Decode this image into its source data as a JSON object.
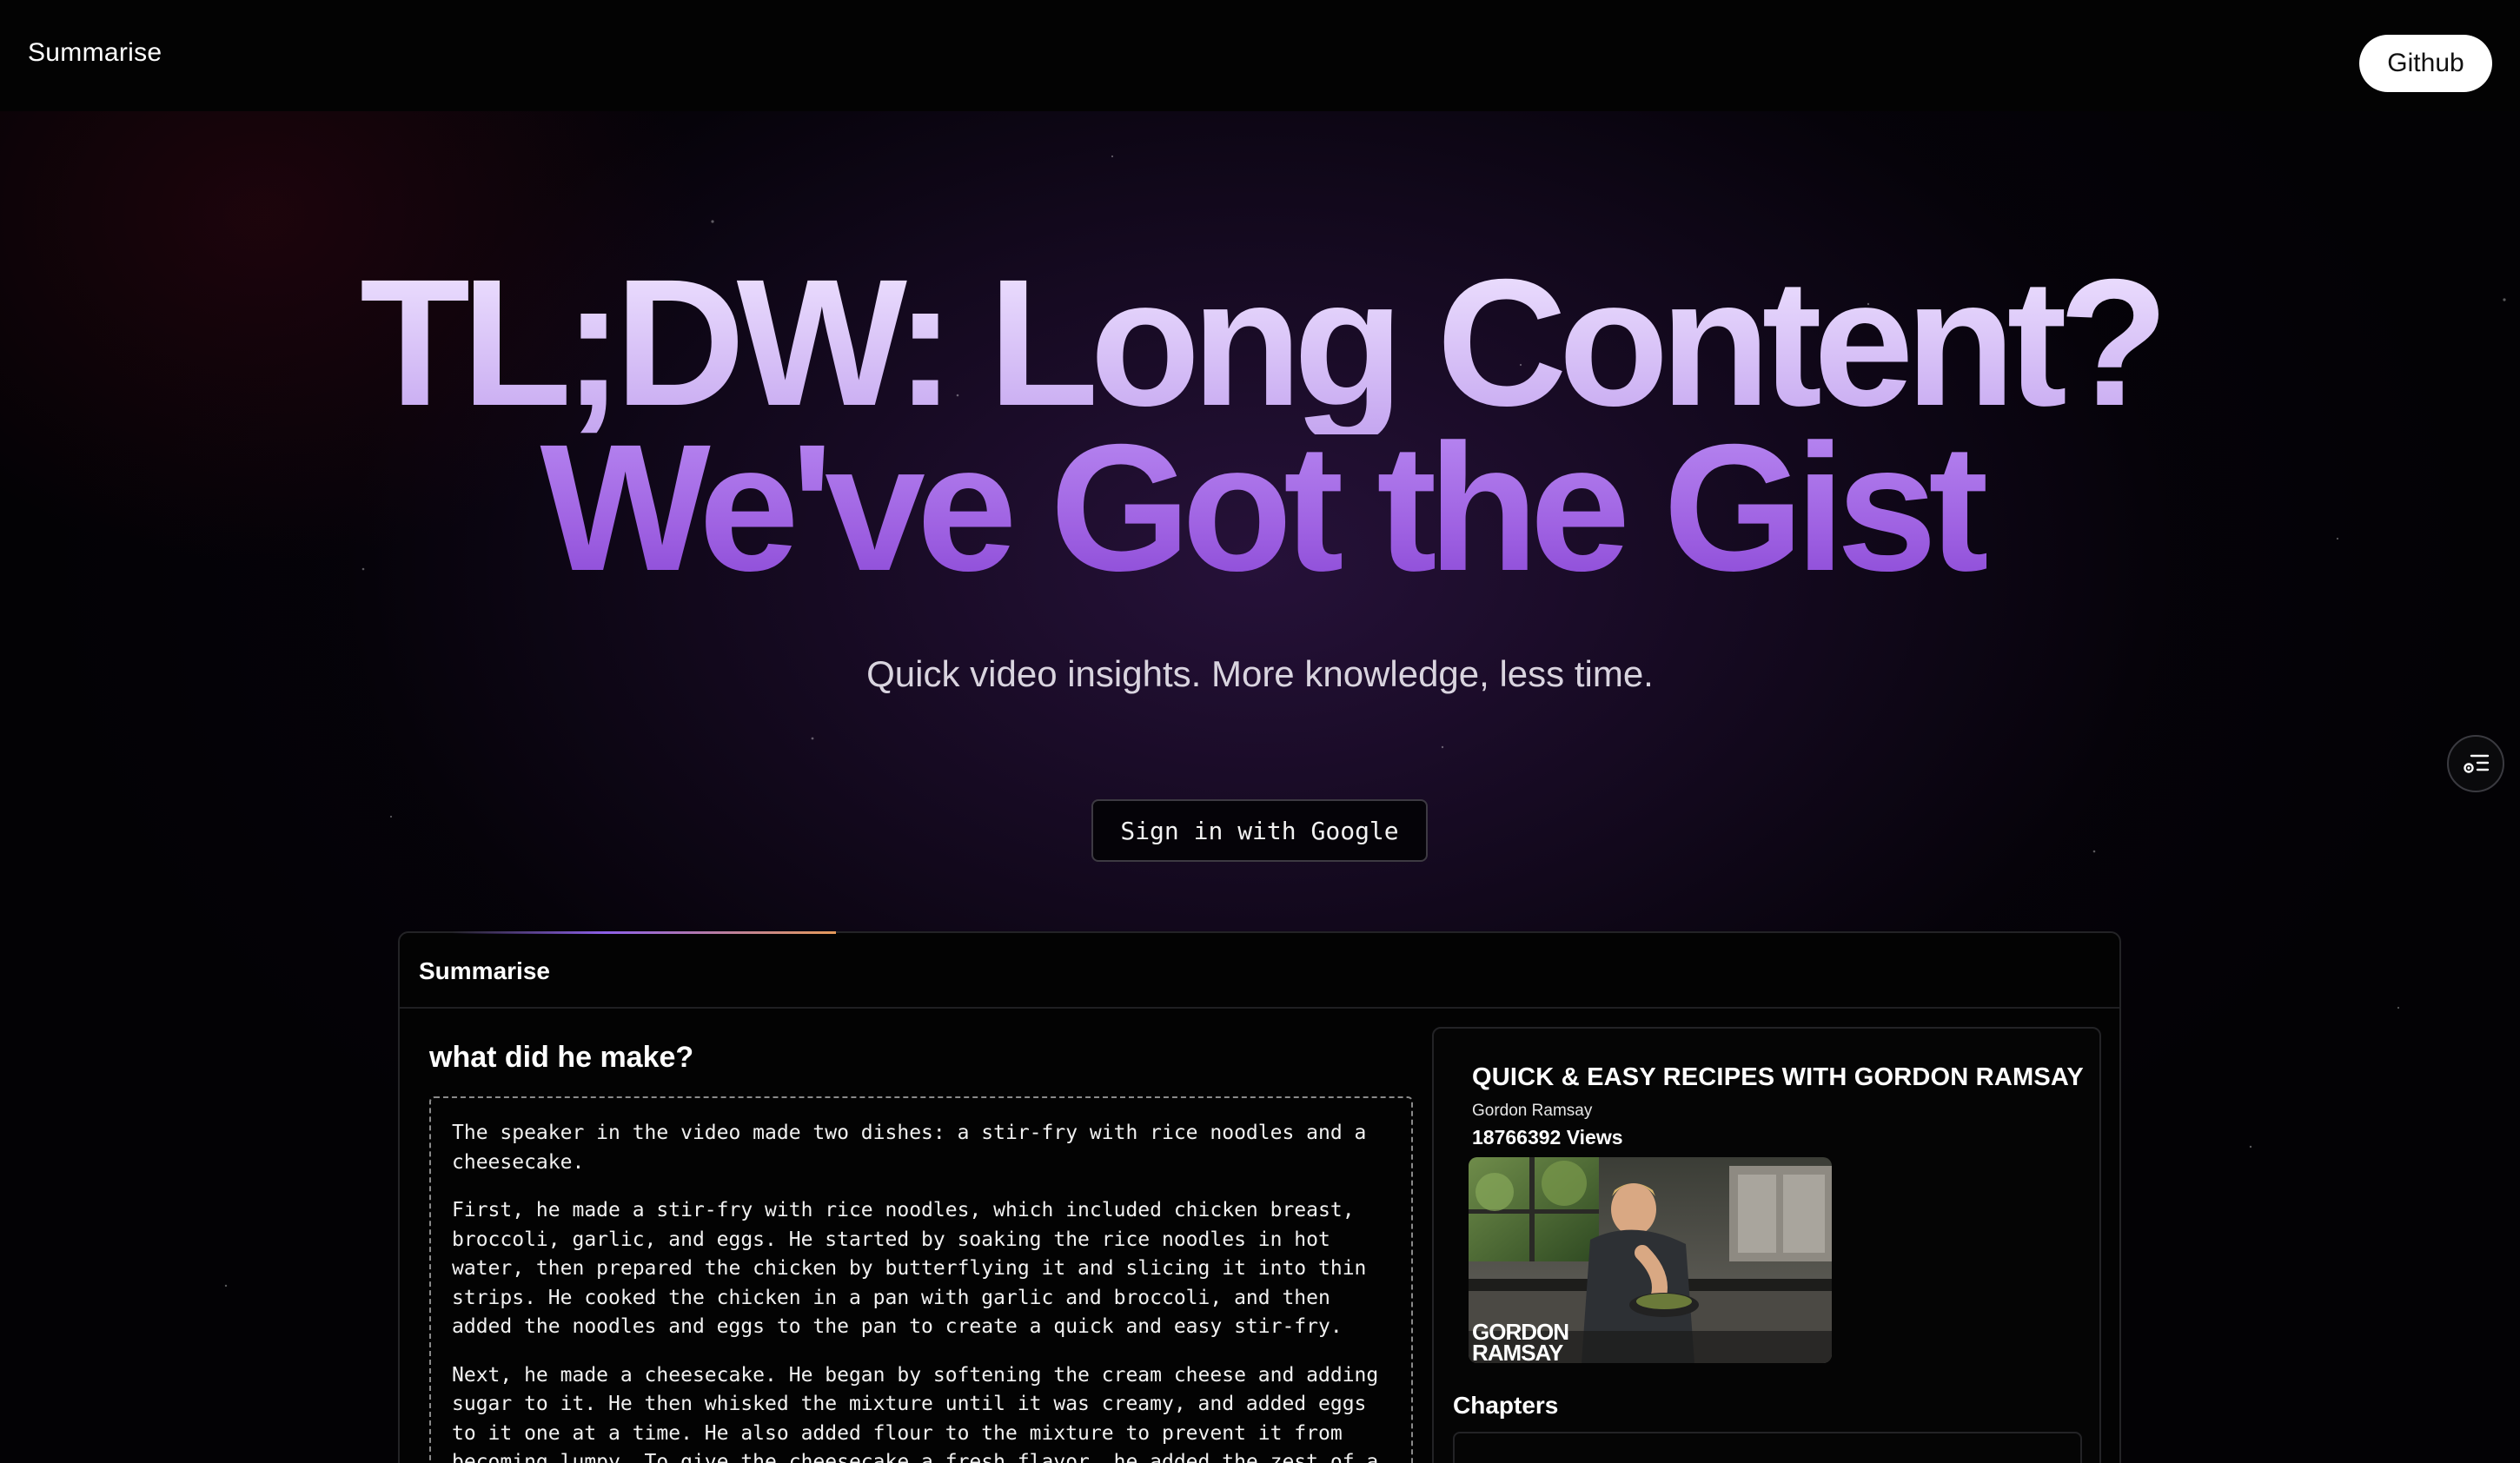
{
  "header": {
    "brand": "Summarise",
    "github_label": "Github"
  },
  "hero": {
    "line1": "TL;DW: Long Content?",
    "line2": "We've Got the Gist",
    "subtitle": "Quick video insights. More knowledge, less time.",
    "signin_label": "Sign in with Google"
  },
  "panel": {
    "title": "Summarise",
    "question": "what did he make?",
    "answer": [
      "The speaker in the video made two dishes: a stir-fry with rice noodles and a cheesecake.",
      "First, he made a stir-fry with rice noodles, which included chicken breast, broccoli, garlic, and eggs. He started by soaking the rice noodles in hot water, then prepared the chicken by butterflying it and slicing it into thin strips. He cooked the chicken in a pan with garlic and broccoli, and then added the noodles and eggs to the pan to create a quick and easy stir-fry.",
      "Next, he made a cheesecake. He began by softening the cream cheese and adding sugar to it. He then whisked the mixture until it was creamy, and added eggs to it one at a time. He also added flour to the mixture to prevent it from becoming lumpy. To give the cheesecake a fresh flavor, he added the zest of a lemon and"
    ]
  },
  "video": {
    "title": "QUICK & EASY RECIPES WITH GORDON RAMSAY",
    "channel": "Gordon Ramsay",
    "views": "18766392 Views",
    "thumbnail_overlay": "GORDON RAMSAY",
    "chapters_label": "Chapters"
  },
  "icons": {
    "side_button": "list-settings-icon"
  },
  "colors": {
    "accent_purple": "#9f62e2",
    "hero_light": "#d8c2f7",
    "background": "#000000"
  }
}
